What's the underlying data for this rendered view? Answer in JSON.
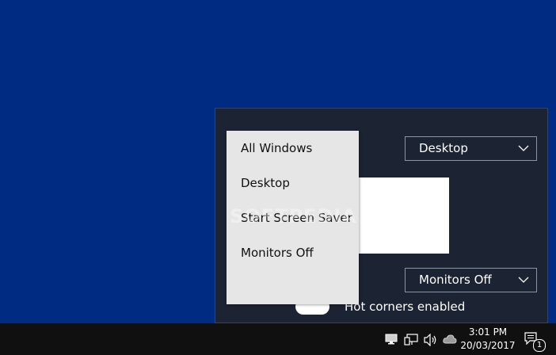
{
  "settings_panel": {
    "top_dropdown_value": "Desktop",
    "bottom_dropdown_value": "Monitors Off",
    "hot_corners_label": "Hot corners enabled"
  },
  "context_menu": {
    "items": [
      "All Windows",
      "Desktop",
      "Start Screen Saver",
      "Monitors Off"
    ]
  },
  "watermark": "SOFTPEDIA",
  "taskbar": {
    "time": "3:01 PM",
    "date": "20/03/2017",
    "notification_count": "1",
    "tray_icons": [
      "display-icon",
      "network-icon",
      "volume-icon",
      "cloud-icon",
      "action-center-icon"
    ]
  },
  "colors": {
    "desktop": "#002b82",
    "panel": "#1c2333",
    "menu": "#e6e6e6",
    "taskbar": "#101010"
  }
}
